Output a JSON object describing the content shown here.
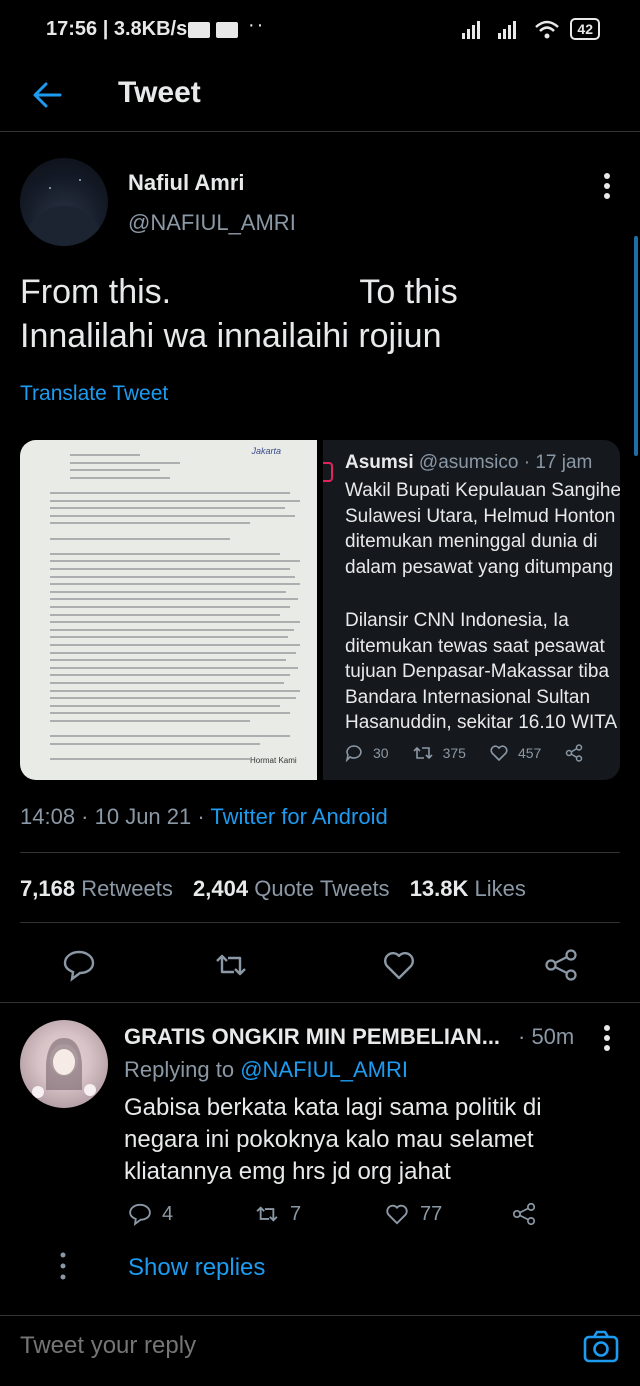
{
  "status_bar": {
    "time": "17:56 | 3.8KB/s",
    "dots": "··",
    "battery": "42"
  },
  "header": {
    "title": "Tweet"
  },
  "tweet": {
    "author_name": "Nafiul Amri",
    "author_handle": "@NAFIUL_AMRI",
    "text_line1": "From this.                    To this",
    "text_line2": "Innalilahi wa innailaihi rojiun",
    "translate_label": "Translate Tweet",
    "quoted_card": {
      "name": "Asumsi",
      "meta": " @asumsico · 17 jam",
      "body_lines": [
        "Wakil Bupati Kepulauan Sangihe",
        "Sulawesi Utara, Helmud Honton",
        "ditemukan meninggal dunia di",
        "dalam pesawat yang ditumpang",
        "",
        "Dilansir CNN Indonesia, Ia",
        "ditemukan tewas saat pesawat",
        "tujuan Denpasar-Makassar tiba",
        "Bandara Internasional Sultan",
        "Hasanuddin, sekitar 16.10 WITA"
      ],
      "replies": "30",
      "retweets": "375",
      "likes": "457"
    },
    "document": {
      "stamp": "Jakarta",
      "signature": "Hormat Kami"
    },
    "timestamp": "14:08 · 10 Jun 21 · ",
    "client": "Twitter for Android",
    "stats": {
      "retweets_count": "7,168",
      "retweets_label": "Retweets",
      "quotes_count": "2,404",
      "quotes_label": "Quote Tweets",
      "likes_count": "13.8K",
      "likes_label": "Likes"
    }
  },
  "reply": {
    "name": "GRATIS ONGKIR MIN PEMBELIAN...",
    "time": "· 50m",
    "replying_prefix": "Replying to ",
    "replying_handle": "@NAFIUL_AMRI",
    "text_lines": [
      "Gabisa berkata kata lagi sama politik di",
      "negara ini pokoknya kalo mau selamet",
      "kliatannya emg hrs jd org jahat"
    ],
    "replies": "4",
    "retweets": "7",
    "likes": "77",
    "show_replies": "Show replies"
  },
  "composer": {
    "placeholder": "Tweet your reply"
  },
  "colors": {
    "accent": "#1d9bf0",
    "background": "#000000",
    "muted": "#8b98a5"
  }
}
